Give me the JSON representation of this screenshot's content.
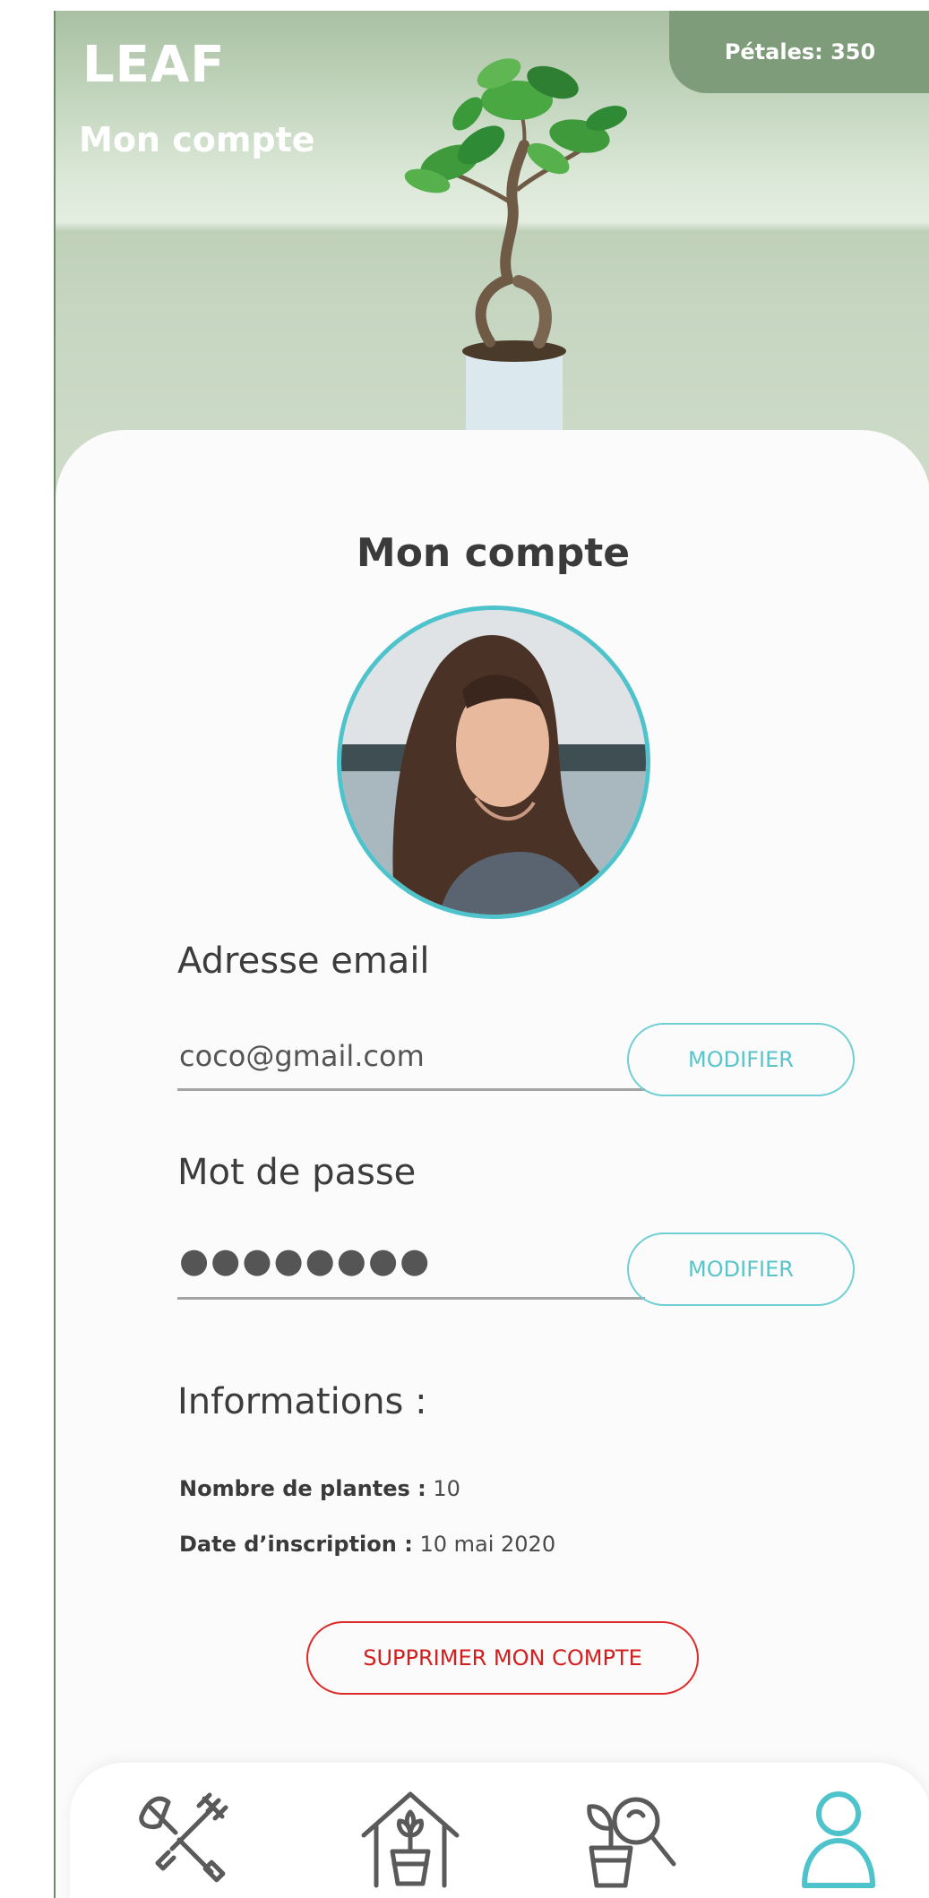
{
  "header": {
    "brand": "LEAF",
    "subtitle": "Mon compte",
    "petals": "Pétales: 350"
  },
  "card": {
    "title": "Mon compte"
  },
  "email": {
    "label": "Adresse email",
    "value": "coco@gmail.com",
    "button": "MODIFIER"
  },
  "password": {
    "label": "Mot de passe",
    "value": "●●●●●●●●",
    "button": "MODIFIER"
  },
  "info": {
    "title": "Informations :",
    "plants_label": "Nombre de plantes :",
    "plants_value": "10",
    "date_label": "Date d’inscription :",
    "date_value": "10 mai 2020"
  },
  "delete_button": "SUPPRIMER MON COMPTE",
  "tabs": [
    {
      "icon": "garden-tools-icon",
      "active": false
    },
    {
      "icon": "plant-house-icon",
      "active": false
    },
    {
      "icon": "plant-search-icon",
      "active": false
    },
    {
      "icon": "user-profile-icon",
      "active": true
    }
  ],
  "colors": {
    "accent": "#4ec3cc",
    "danger": "#e02a2a",
    "header_green": "#7e9b7a"
  }
}
